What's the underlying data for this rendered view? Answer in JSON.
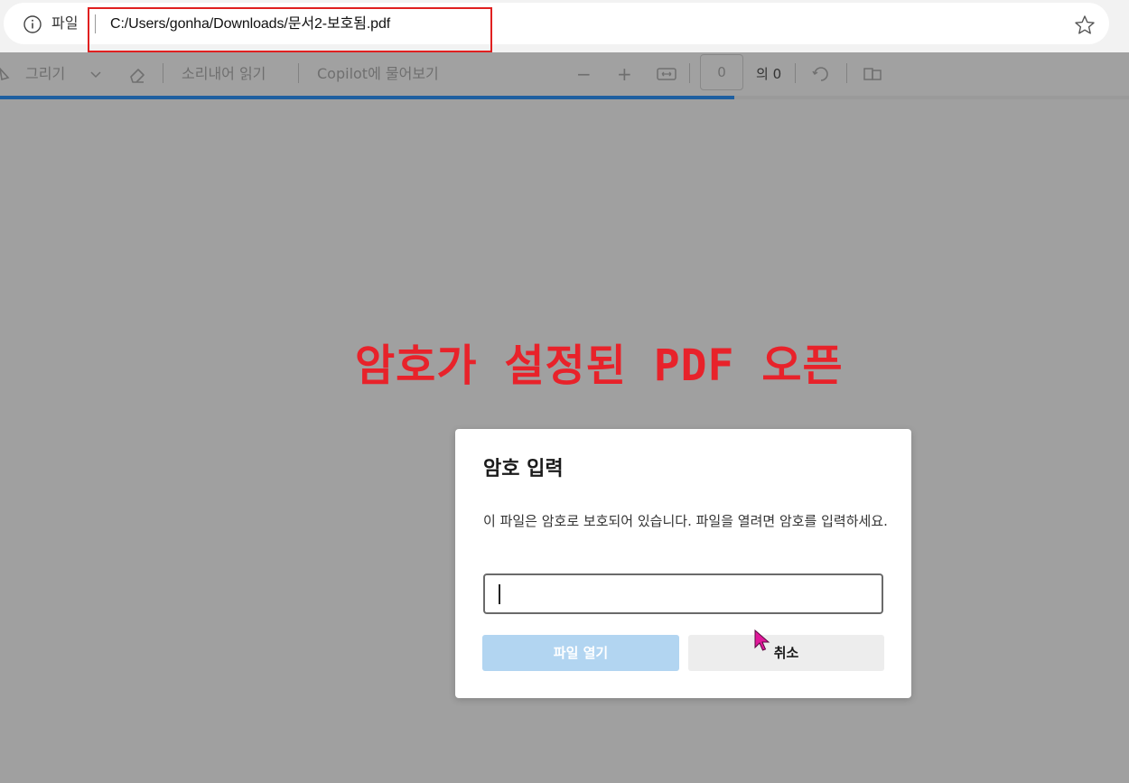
{
  "browser": {
    "address_prefix": "파일",
    "url": "C:/Users/gonha/Downloads/문서2-보호됨.pdf",
    "icons": {
      "info": "info-icon",
      "favorite": "star-icon"
    }
  },
  "toolbar": {
    "draw_label": "그리기",
    "read_aloud_label": "소리내어 읽기",
    "copilot_label": "Copilot에 물어보기",
    "zoom_out_symbol": "−",
    "zoom_in_symbol": "+",
    "page_number": "0",
    "page_total": "의 0",
    "load_progress": 0.65
  },
  "annotation": {
    "text": "암호가 설정된 PDF 오픈",
    "color": "#e8222a"
  },
  "dialog": {
    "title": "암호 입력",
    "message": "이 파일은 암호로 보호되어 있습니다. 파일을 열려면 암호를 입력하세요.",
    "password_value": "",
    "open_button": "파일 열기",
    "cancel_button": "취소"
  },
  "colors": {
    "overlay": "#a0a0a0",
    "primary_disabled": "#b2d5f1",
    "highlight_box": "#e02020",
    "cursor": "#e0189a"
  }
}
